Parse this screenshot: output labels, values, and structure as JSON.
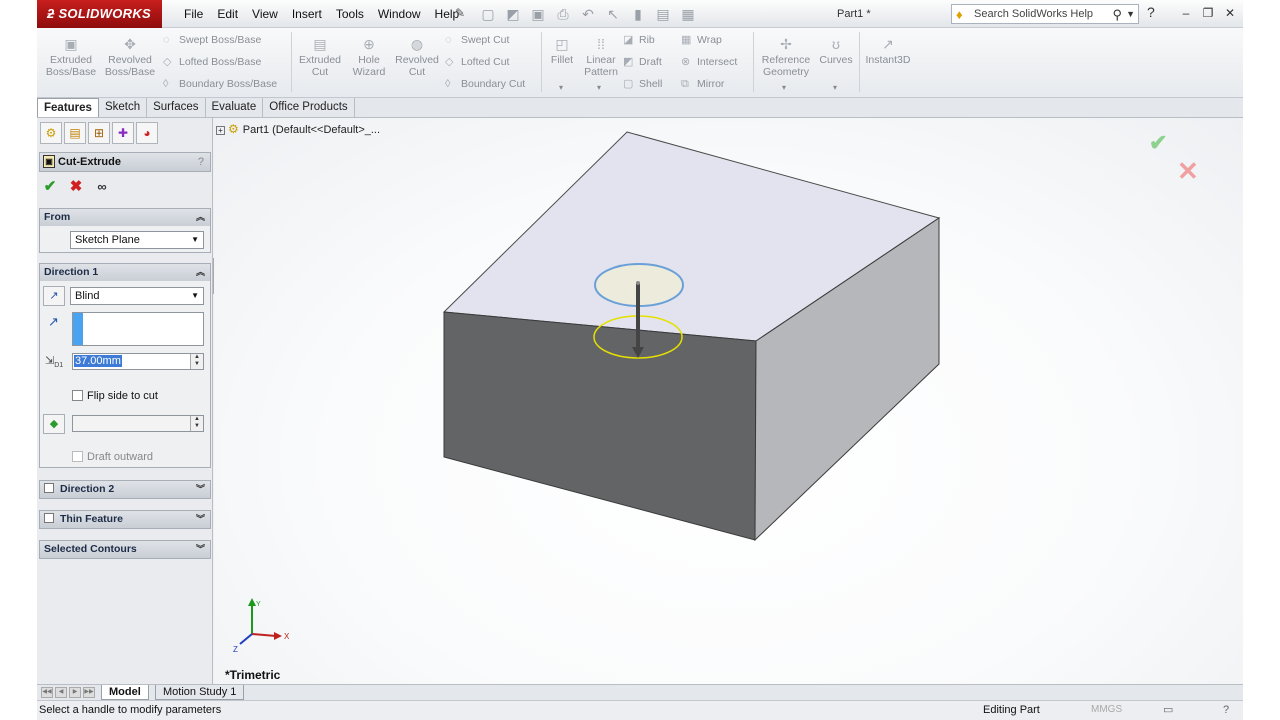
{
  "app": {
    "logo": "SOLIDWORKS",
    "document_title": "Part1 *",
    "menu": [
      "File",
      "Edit",
      "View",
      "Insert",
      "Tools",
      "Window",
      "Help"
    ],
    "search_placeholder": "Search SolidWorks Help"
  },
  "commands": {
    "extruded_boss": "Extruded\nBoss/Base",
    "revolved_boss": "Revolved\nBoss/Base",
    "swept_boss": "Swept Boss/Base",
    "lofted_boss": "Lofted Boss/Base",
    "boundary_boss": "Boundary Boss/Base",
    "extruded_cut": "Extruded\nCut",
    "hole_wizard": "Hole\nWizard",
    "revolved_cut": "Revolved\nCut",
    "swept_cut": "Swept Cut",
    "lofted_cut": "Lofted Cut",
    "boundary_cut": "Boundary Cut",
    "fillet": "Fillet",
    "linear_pattern": "Linear\nPattern",
    "rib": "Rib",
    "draft": "Draft",
    "shell": "Shell",
    "wrap": "Wrap",
    "intersect": "Intersect",
    "mirror": "Mirror",
    "reference_geometry": "Reference\nGeometry",
    "curves": "Curves",
    "instant3d": "Instant3D"
  },
  "tabs": [
    "Features",
    "Sketch",
    "Surfaces",
    "Evaluate",
    "Office Products"
  ],
  "property_manager": {
    "title": "Cut-Extrude",
    "help": "?",
    "from": {
      "header": "From",
      "value": "Sketch Plane"
    },
    "direction1": {
      "header": "Direction 1",
      "end_condition": "Blind",
      "depth": "37.00mm",
      "depth_tag": "D1",
      "flip_side": "Flip side to cut",
      "draft_outward": "Draft outward"
    },
    "direction2": "Direction 2",
    "thin_feature": "Thin Feature",
    "selected_contours": "Selected Contours"
  },
  "viewport": {
    "tree_item": "Part1  (Default<<Default>_...",
    "view_name": "*Trimetric",
    "axes": {
      "x": "X",
      "y": "Y",
      "z": "Z"
    }
  },
  "bottom_tabs": [
    "Model",
    "Motion Study 1"
  ],
  "status": {
    "message": "Select a handle to modify parameters",
    "mode": "Editing Part",
    "units": "MMGS"
  },
  "colors": {
    "logo_red": "#b21616",
    "ok_green": "#2e9b2e",
    "cancel_red": "#d12020",
    "accent_blue": "#3d7bd6",
    "box_top": "#e2e3ee",
    "box_side": "#636466"
  },
  "icons": {
    "pm_tabs": [
      "feature-manager-icon",
      "property-manager-icon",
      "configuration-manager-icon",
      "dim-xpert-icon",
      "display-manager-icon"
    ]
  }
}
